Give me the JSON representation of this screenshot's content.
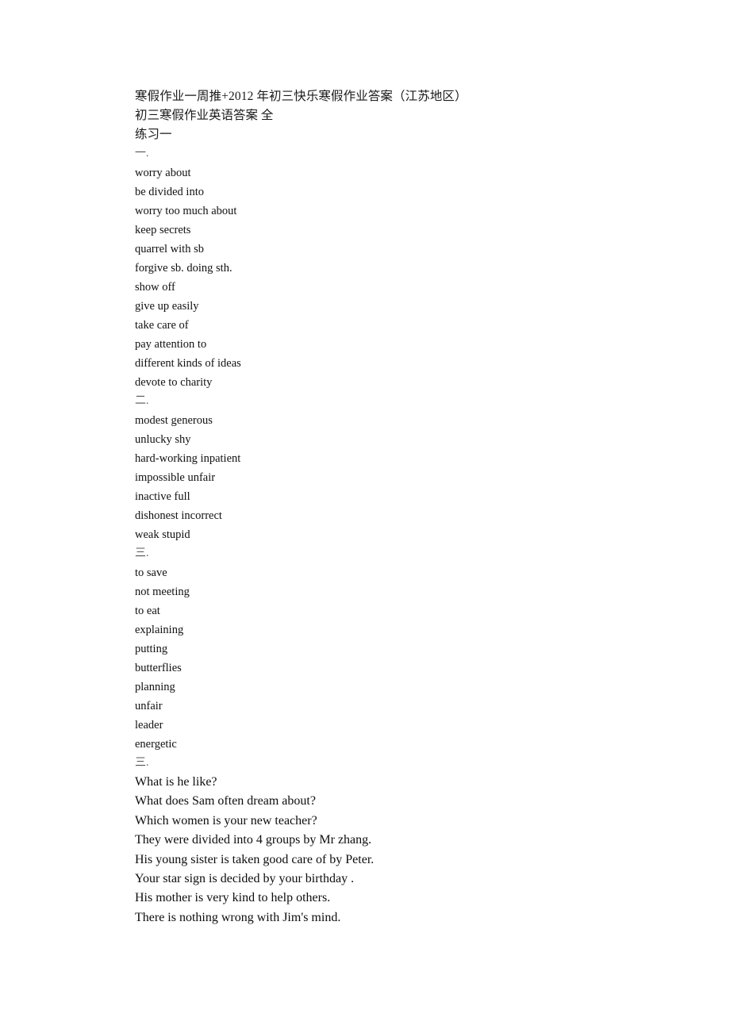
{
  "document": {
    "title": "寒假作业一周推+2012 年初三快乐寒假作业答案（江苏地区）",
    "subtitle": "初三寒假作业英语答案 全",
    "exercise_label": "练习一",
    "sections": [
      {
        "marker": "一.",
        "kind": "phrase-list",
        "items": [
          "worry about",
          "be divided into",
          "worry too much about",
          "keep secrets",
          "quarrel with sb",
          "forgive sb. doing sth.",
          "show off",
          "give up easily",
          "take care of",
          "pay attention to",
          "different kinds of ideas",
          "devote to charity"
        ]
      },
      {
        "marker": "二.",
        "kind": "adjective-pairs",
        "items": [
          "modest generous",
          "unlucky shy",
          "hard-working inpatient",
          "impossible unfair",
          "inactive full",
          "dishonest incorrect",
          "weak stupid"
        ]
      },
      {
        "marker": "三.",
        "kind": "verb-forms",
        "items": [
          "to save",
          "not meeting",
          "to eat",
          "explaining",
          "putting",
          "butterflies",
          "planning",
          "unfair",
          "leader",
          "energetic"
        ]
      },
      {
        "marker": "三.",
        "kind": "sentences",
        "items": [
          "What is he like?",
          "What does Sam often dream about?",
          "Which women is your new teacher?",
          "They were divided into 4 groups by Mr zhang.",
          "His young sister is taken good care of by Peter.",
          "Your star sign is decided by your birthday .",
          "His mother is very kind to help others.",
          "There is nothing wrong with Jim's mind."
        ]
      }
    ]
  }
}
